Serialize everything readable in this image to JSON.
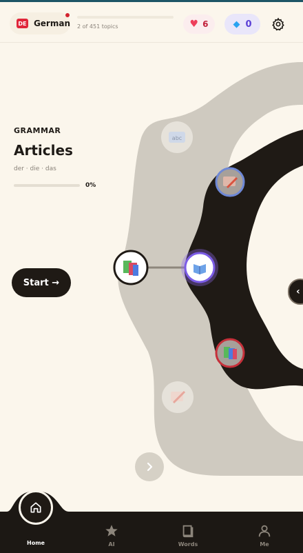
{
  "header": {
    "language": {
      "flag_text": "DE",
      "name": "German",
      "flag_color": "#E0263A"
    },
    "topics_progress": "2 of 451 topics",
    "hearts": {
      "count": "6",
      "icon": "heart-icon"
    },
    "gems": {
      "count": "0",
      "icon": "diamond-icon"
    },
    "settings_icon": "gear-icon"
  },
  "lesson": {
    "category": "GRAMMAR",
    "title": "Articles",
    "subtitle": "der · die · das",
    "progress_percent": 0,
    "progress_label": "0%",
    "start_label": "Start →"
  },
  "map": {
    "nodes": [
      {
        "name": "node-abc",
        "icon": "abc-icon",
        "state": "locked"
      },
      {
        "name": "node-pencil",
        "icon": "pencil-icon",
        "state": "available"
      },
      {
        "name": "node-books-current",
        "icon": "books-icon",
        "state": "current"
      },
      {
        "name": "node-open-book",
        "icon": "open-book-icon",
        "state": "selected"
      },
      {
        "name": "node-books-red",
        "icon": "books-icon",
        "state": "available"
      },
      {
        "name": "node-pencil-locked",
        "icon": "pencil-icon",
        "state": "locked"
      }
    ],
    "side_handle": "‹",
    "next_icon": "chevron-right-icon"
  },
  "nav": {
    "items": [
      {
        "label": "Home",
        "icon": "home-icon",
        "active": true
      },
      {
        "label": "AI",
        "icon": "star-icon",
        "active": false
      },
      {
        "label": "Words",
        "icon": "book-icon",
        "active": false
      },
      {
        "label": "Me",
        "icon": "person-icon",
        "active": false
      }
    ]
  },
  "colors": {
    "background": "#FBF6EC",
    "dark": "#1F1A15",
    "accent_purple": "#7B5CE6",
    "heart": "#EE3E5B",
    "gem": "#2AA3F0"
  }
}
